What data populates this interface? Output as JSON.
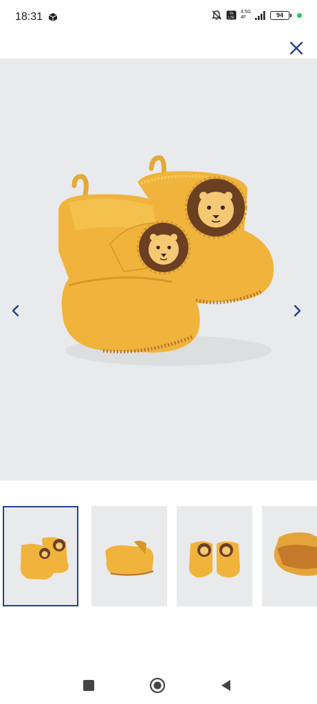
{
  "status_bar": {
    "time": "18:31",
    "network_top": "4.5G",
    "network_bottom": "4F",
    "battery": "94",
    "icons": [
      "package-icon",
      "mute-bell-icon",
      "volte-icon",
      "signal-icon",
      "battery-icon",
      "green-dot-icon"
    ]
  },
  "gallery": {
    "close_icon": "close-icon",
    "prev_icon": "chevron-left-icon",
    "next_icon": "chevron-right-icon",
    "thumbnail_count": 4,
    "active_thumbnail": 1
  },
  "system_nav": {
    "icons": [
      "recent-apps-icon",
      "home-icon",
      "back-icon"
    ]
  },
  "colors": {
    "accent": "#1f3f95",
    "image_bg": "#e9eaec",
    "bootie": "#f0b43c",
    "bootie_dark": "#d9952a",
    "lion_mane": "#6b3f22"
  }
}
